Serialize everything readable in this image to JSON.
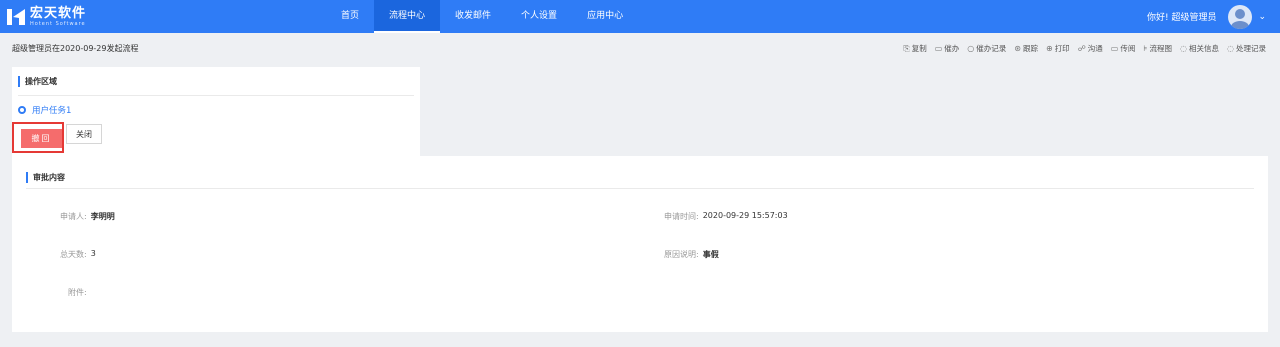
{
  "brand": {
    "name_cn": "宏天软件",
    "name_en": "Hotent Software",
    "color": "#2f7cf6"
  },
  "nav": [
    {
      "label": "首页",
      "active": false
    },
    {
      "label": "流程中心",
      "active": true
    },
    {
      "label": "收发邮件",
      "active": false
    },
    {
      "label": "个人设置",
      "active": false
    },
    {
      "label": "应用中心",
      "active": false
    }
  ],
  "user": {
    "greeting": "你好! 超级管理员",
    "avatar_icon": "user-avatar-icon",
    "caret": "⌄"
  },
  "flow": {
    "title": "超级管理员在2020-09-29发起流程"
  },
  "actions": [
    {
      "icon": "copy-icon",
      "glyph": "⎘",
      "label": "复制"
    },
    {
      "icon": "urge-icon",
      "glyph": "▭",
      "label": "催办"
    },
    {
      "icon": "search-icon",
      "glyph": "○",
      "label": "催办记录"
    },
    {
      "icon": "track-icon",
      "glyph": "⊛",
      "label": "跟踪"
    },
    {
      "icon": "print-icon",
      "glyph": "⊕",
      "label": "打印"
    },
    {
      "icon": "communicate-icon",
      "glyph": "☍",
      "label": "沟通"
    },
    {
      "icon": "forward-icon",
      "glyph": "▭",
      "label": "传阅"
    },
    {
      "icon": "flowchart-icon",
      "glyph": "⊧",
      "label": "流程图"
    },
    {
      "icon": "related-info-icon",
      "glyph": "◌",
      "label": "相关信息"
    },
    {
      "icon": "history-icon",
      "glyph": "◌",
      "label": "处理记录"
    }
  ],
  "operation": {
    "title": "操作区域",
    "task_label": "用户任务1",
    "withdraw_label": "撤回",
    "close_label": "关闭",
    "withdraw_color": "#f56c6c",
    "highlight_color": "#e53935"
  },
  "approval": {
    "title": "审批内容",
    "applicant": {
      "label": "申请人:",
      "value": "李明明"
    },
    "apply_time": {
      "label": "申请时间:",
      "value": "2020-09-29 15:57:03"
    },
    "total_days": {
      "label": "总天数:",
      "value": "3"
    },
    "reason": {
      "label": "原因说明:",
      "value": "事假"
    },
    "attachment": {
      "label": "附件:",
      "value": ""
    }
  }
}
